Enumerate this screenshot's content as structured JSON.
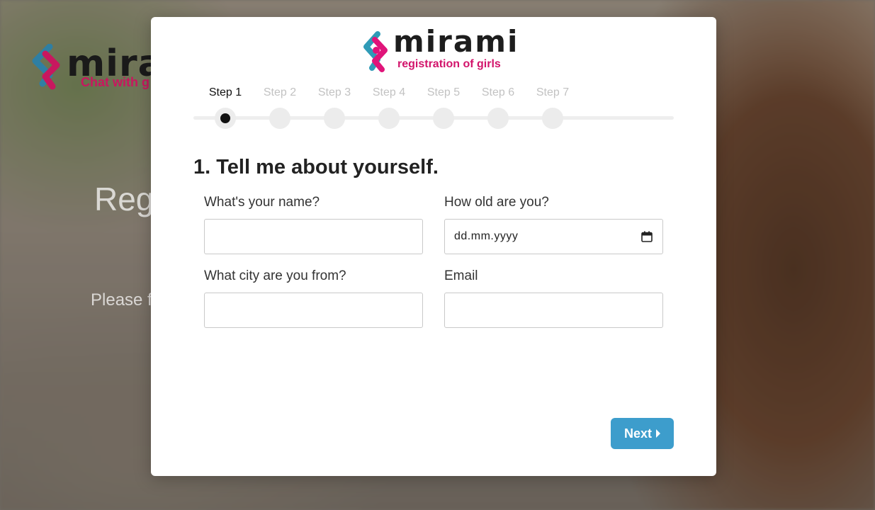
{
  "background": {
    "logo_word": "mira",
    "logo_tagline": "Chat with g",
    "heading": "Reg",
    "subtext": "Please f"
  },
  "modal": {
    "brand": {
      "word": "mirami",
      "tagline": "registration of girls",
      "colors": {
        "pink": "#e0147a",
        "teal": "#2f9bb7"
      }
    },
    "steps": [
      {
        "label": "Step 1",
        "active": true
      },
      {
        "label": "Step 2",
        "active": false
      },
      {
        "label": "Step 3",
        "active": false
      },
      {
        "label": "Step 4",
        "active": false
      },
      {
        "label": "Step 5",
        "active": false
      },
      {
        "label": "Step 6",
        "active": false
      },
      {
        "label": "Step 7",
        "active": false
      }
    ],
    "title": "1. Tell me about yourself.",
    "fields": {
      "name": {
        "label": "What's your name?",
        "value": ""
      },
      "age": {
        "label": "How old are you?",
        "placeholder": "dd.mm.yyyy"
      },
      "city": {
        "label": "What city are you from?",
        "value": ""
      },
      "email": {
        "label": "Email",
        "value": ""
      }
    },
    "next_button": {
      "label": "Next",
      "color": "#3d9dcc"
    }
  }
}
